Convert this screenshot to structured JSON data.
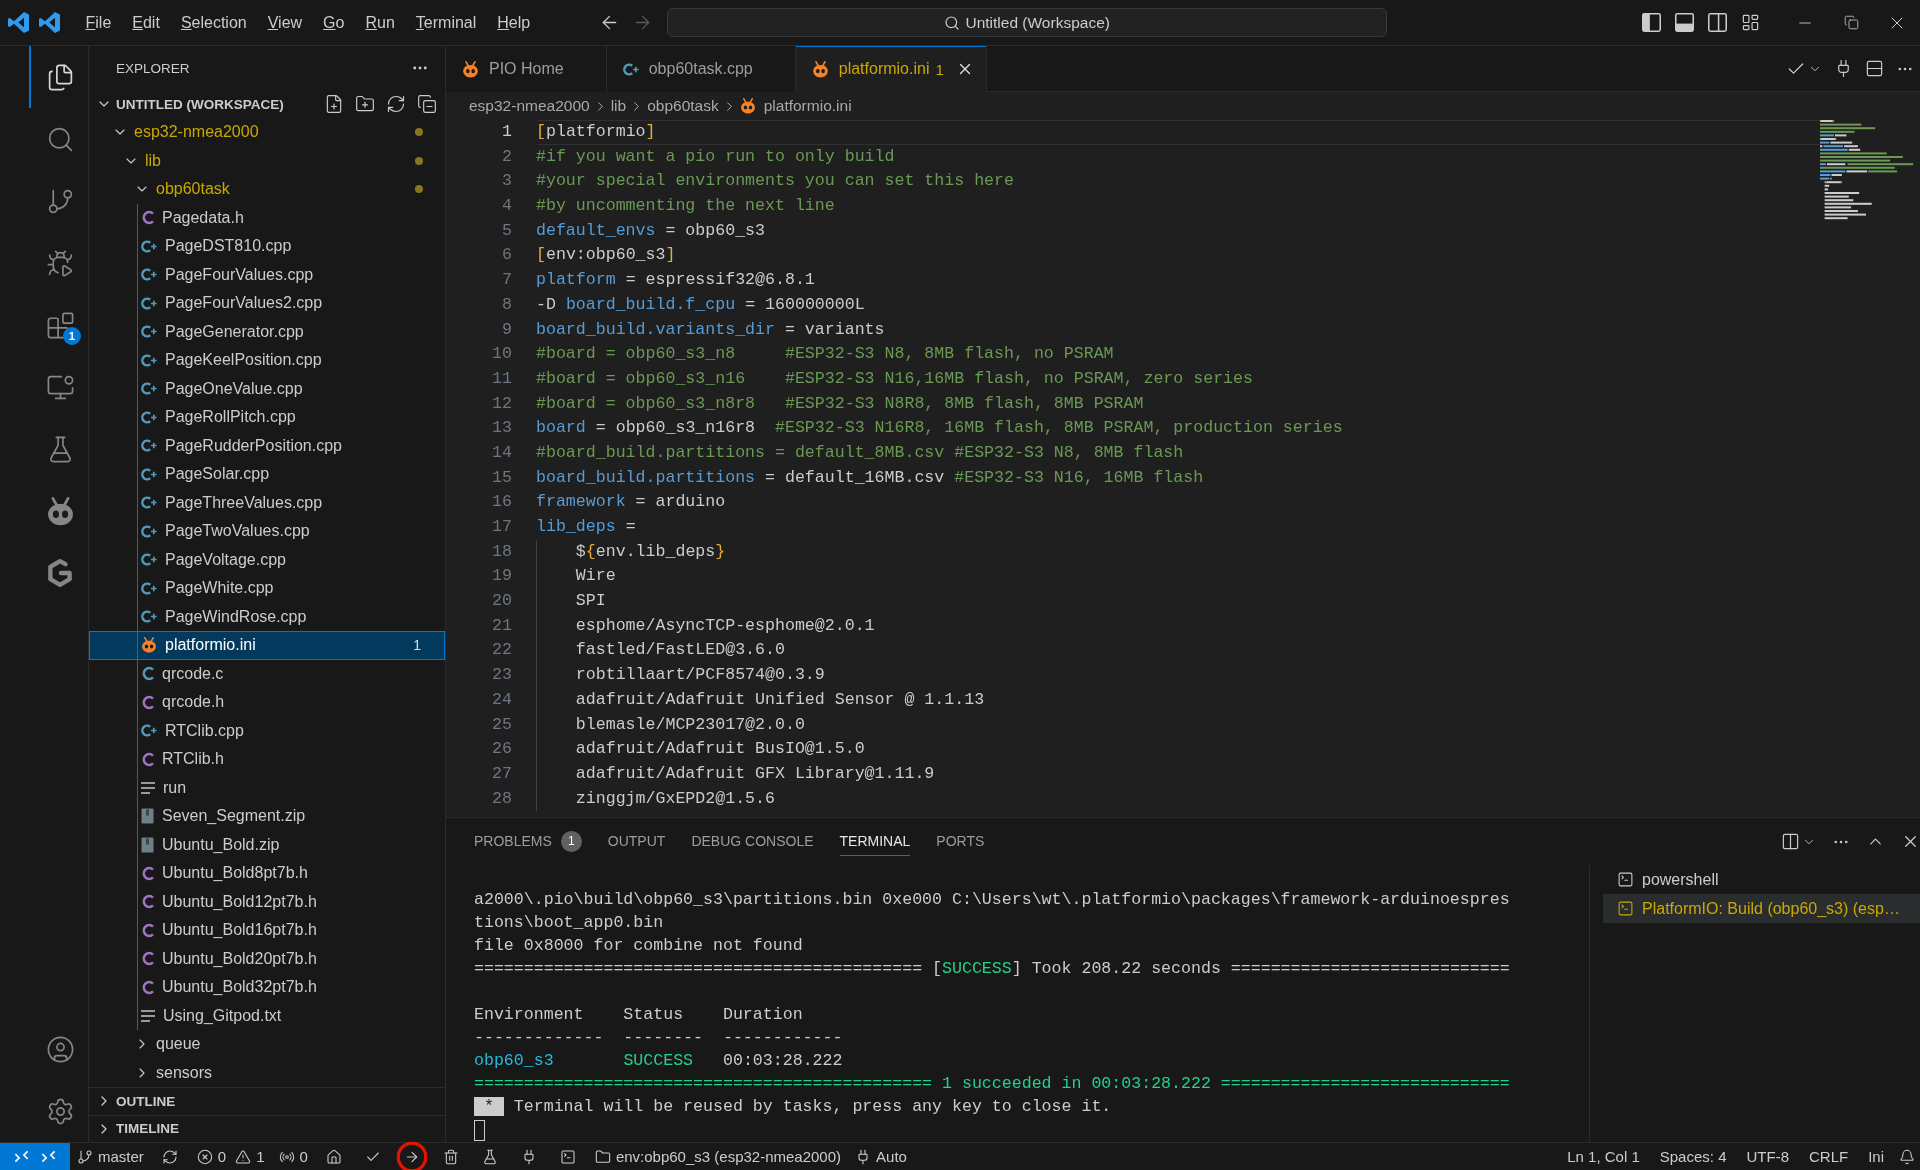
{
  "title_bar": {
    "menu": [
      "File",
      "Edit",
      "Selection",
      "View",
      "Go",
      "Run",
      "Terminal",
      "Help"
    ],
    "navigation": [
      {
        "kind": "back",
        "disabled": false
      },
      {
        "kind": "forward",
        "disabled": true
      }
    ],
    "command_center": "Untitled (Workspace)",
    "layout_toggles": [
      {
        "kind": "primary-sidebar",
        "on": true
      },
      {
        "kind": "panel",
        "on": true
      },
      {
        "kind": "secondary-sidebar",
        "on": false
      }
    ]
  },
  "activity_bar": {
    "top": [
      {
        "kind": "explorer",
        "selected": true
      },
      {
        "kind": "search",
        "selected": false
      },
      {
        "kind": "source-control",
        "selected": false
      },
      {
        "kind": "run-debug",
        "selected": false
      },
      {
        "kind": "extensions",
        "selected": false,
        "badge": "1"
      },
      {
        "kind": "remote-explorer",
        "selected": false
      },
      {
        "kind": "testing",
        "selected": false
      },
      {
        "kind": "platformio",
        "selected": false
      },
      {
        "kind": "gitpod",
        "selected": false
      }
    ],
    "bottom": [
      {
        "kind": "accounts"
      },
      {
        "kind": "manage"
      }
    ]
  },
  "explorer": {
    "title": "EXPLORER",
    "workspace": {
      "label": "UNTITLED (WORKSPACE)",
      "expanded": true
    },
    "tree": [
      {
        "label": "esp32-nmea2000",
        "kind": "folder",
        "expanded": true,
        "selected": false,
        "warning": true,
        "children": [
          {
            "label": "lib",
            "kind": "folder",
            "expanded": true,
            "selected": false,
            "warning": true,
            "children": [
              {
                "label": "obp60task",
                "kind": "folder",
                "expanded": true,
                "selected": false,
                "warning": true,
                "children": [
                  {
                    "label": "Pagedata.h",
                    "kind": "c-header",
                    "selected": false,
                    "warning": false
                  },
                  {
                    "label": "PageDST810.cpp",
                    "kind": "cpp",
                    "selected": false,
                    "warning": false
                  },
                  {
                    "label": "PageFourValues.cpp",
                    "kind": "cpp",
                    "selected": false,
                    "warning": false
                  },
                  {
                    "label": "PageFourValues2.cpp",
                    "kind": "cpp",
                    "selected": false,
                    "warning": false
                  },
                  {
                    "label": "PageGenerator.cpp",
                    "kind": "cpp",
                    "selected": false,
                    "warning": false
                  },
                  {
                    "label": "PageKeelPosition.cpp",
                    "kind": "cpp",
                    "selected": false,
                    "warning": false
                  },
                  {
                    "label": "PageOneValue.cpp",
                    "kind": "cpp",
                    "selected": false,
                    "warning": false
                  },
                  {
                    "label": "PageRollPitch.cpp",
                    "kind": "cpp",
                    "selected": false,
                    "warning": false
                  },
                  {
                    "label": "PageRudderPosition.cpp",
                    "kind": "cpp",
                    "selected": false,
                    "warning": false
                  },
                  {
                    "label": "PageSolar.cpp",
                    "kind": "cpp",
                    "selected": false,
                    "warning": false
                  },
                  {
                    "label": "PageThreeValues.cpp",
                    "kind": "cpp",
                    "selected": false,
                    "warning": false
                  },
                  {
                    "label": "PageTwoValues.cpp",
                    "kind": "cpp",
                    "selected": false,
                    "warning": false
                  },
                  {
                    "label": "PageVoltage.cpp",
                    "kind": "cpp",
                    "selected": false,
                    "warning": false
                  },
                  {
                    "label": "PageWhite.cpp",
                    "kind": "cpp",
                    "selected": false,
                    "warning": false
                  },
                  {
                    "label": "PageWindRose.cpp",
                    "kind": "cpp",
                    "selected": false,
                    "warning": false
                  },
                  {
                    "label": "platformio.ini",
                    "kind": "platformio",
                    "selected": true,
                    "warning": false,
                    "badge": "1"
                  },
                  {
                    "label": "qrcode.c",
                    "kind": "c-source",
                    "selected": false,
                    "warning": false
                  },
                  {
                    "label": "qrcode.h",
                    "kind": "c-header",
                    "selected": false,
                    "warning": false
                  },
                  {
                    "label": "RTClib.cpp",
                    "kind": "cpp",
                    "selected": false,
                    "warning": false
                  },
                  {
                    "label": "RTClib.h",
                    "kind": "c-header",
                    "selected": false,
                    "warning": false
                  },
                  {
                    "label": "run",
                    "kind": "text",
                    "selected": false,
                    "warning": false
                  },
                  {
                    "label": "Seven_Segment.zip",
                    "kind": "zip",
                    "selected": false,
                    "warning": false
                  },
                  {
                    "label": "Ubuntu_Bold.zip",
                    "kind": "zip",
                    "selected": false,
                    "warning": false
                  },
                  {
                    "label": "Ubuntu_Bold8pt7b.h",
                    "kind": "c-header",
                    "selected": false,
                    "warning": false
                  },
                  {
                    "label": "Ubuntu_Bold12pt7b.h",
                    "kind": "c-header",
                    "selected": false,
                    "warning": false
                  },
                  {
                    "label": "Ubuntu_Bold16pt7b.h",
                    "kind": "c-header",
                    "selected": false,
                    "warning": false
                  },
                  {
                    "label": "Ubuntu_Bold20pt7b.h",
                    "kind": "c-header",
                    "selected": false,
                    "warning": false
                  },
                  {
                    "label": "Ubuntu_Bold32pt7b.h",
                    "kind": "c-header",
                    "selected": false,
                    "warning": false
                  },
                  {
                    "label": "Using_Gitpod.txt",
                    "kind": "text",
                    "selected": false,
                    "warning": false
                  }
                ]
              },
              {
                "label": "queue",
                "kind": "folder",
                "expanded": false,
                "selected": false,
                "warning": false
              },
              {
                "label": "sensors",
                "kind": "folder",
                "expanded": false,
                "selected": false,
                "warning": false
              }
            ]
          }
        ]
      }
    ],
    "sections": [
      {
        "label": "OUTLINE",
        "expanded": false
      },
      {
        "label": "TIMELINE",
        "expanded": false
      }
    ]
  },
  "editor": {
    "tabs": [
      {
        "label": "PIO Home",
        "kind": "platformio",
        "selected": false,
        "warning": false
      },
      {
        "label": "obp60task.cpp",
        "kind": "cpp",
        "selected": false,
        "warning": false
      },
      {
        "label": "platformio.ini",
        "kind": "platformio",
        "selected": true,
        "warning": true,
        "badge": "1"
      }
    ],
    "breadcrumbs": [
      {
        "label": "esp32-nmea2000",
        "kind": "folder"
      },
      {
        "label": "lib",
        "kind": "folder"
      },
      {
        "label": "obp60task",
        "kind": "folder"
      },
      {
        "label": "platformio.ini",
        "kind": "platformio"
      }
    ],
    "lines": [
      {
        "number": "1",
        "current": true,
        "indented": false,
        "tokens": [
          {
            "kind": "bracket",
            "text": "["
          },
          {
            "kind": "text",
            "text": "platformio"
          },
          {
            "kind": "bracket",
            "text": "]"
          }
        ]
      },
      {
        "number": "2",
        "current": false,
        "indented": false,
        "tokens": [
          {
            "kind": "comment",
            "text": "#if you want a pio run to only build"
          }
        ]
      },
      {
        "number": "3",
        "current": false,
        "indented": false,
        "tokens": [
          {
            "kind": "comment",
            "text": "#your special environments you can set this here"
          }
        ]
      },
      {
        "number": "4",
        "current": false,
        "indented": false,
        "tokens": [
          {
            "kind": "comment",
            "text": "#by uncommenting the next line"
          }
        ]
      },
      {
        "number": "5",
        "current": false,
        "indented": false,
        "tokens": [
          {
            "kind": "key",
            "text": "default_envs"
          },
          {
            "kind": "text",
            "text": " = obp60_s3"
          }
        ]
      },
      {
        "number": "6",
        "current": false,
        "indented": false,
        "tokens": [
          {
            "kind": "bracket",
            "text": "["
          },
          {
            "kind": "text",
            "text": "env:obp60_s3"
          },
          {
            "kind": "bracket",
            "text": "]"
          }
        ]
      },
      {
        "number": "7",
        "current": false,
        "indented": false,
        "tokens": [
          {
            "kind": "key",
            "text": "platform"
          },
          {
            "kind": "text",
            "text": " = espressif32@6.8.1"
          }
        ]
      },
      {
        "number": "8",
        "current": false,
        "indented": false,
        "tokens": [
          {
            "kind": "text",
            "text": "-D "
          },
          {
            "kind": "key",
            "text": "board_build.f_cpu"
          },
          {
            "kind": "text",
            "text": " = 160000000L"
          }
        ]
      },
      {
        "number": "9",
        "current": false,
        "indented": false,
        "tokens": [
          {
            "kind": "key",
            "text": "board_build.variants_dir"
          },
          {
            "kind": "text",
            "text": " = variants"
          }
        ]
      },
      {
        "number": "10",
        "current": false,
        "indented": false,
        "tokens": [
          {
            "kind": "comment",
            "text": "#board = obp60_s3_n8     #ESP32-S3 N8, 8MB flash, no PSRAM"
          }
        ]
      },
      {
        "number": "11",
        "current": false,
        "indented": false,
        "tokens": [
          {
            "kind": "comment",
            "text": "#board = obp60_s3_n16    #ESP32-S3 N16,16MB flash, no PSRAM, zero series"
          }
        ]
      },
      {
        "number": "12",
        "current": false,
        "indented": false,
        "tokens": [
          {
            "kind": "comment",
            "text": "#board = obp60_s3_n8r8   #ESP32-S3 N8R8, 8MB flash, 8MB PSRAM"
          }
        ]
      },
      {
        "number": "13",
        "current": false,
        "indented": false,
        "tokens": [
          {
            "kind": "key",
            "text": "board"
          },
          {
            "kind": "text",
            "text": " = obp60_s3_n16r8  "
          },
          {
            "kind": "comment",
            "text": "#ESP32-S3 N16R8, 16MB flash, 8MB PSRAM, production series"
          }
        ]
      },
      {
        "number": "14",
        "current": false,
        "indented": false,
        "tokens": [
          {
            "kind": "comment",
            "text": "#board_build.partitions = default_8MB.csv #ESP32-S3 N8, 8MB flash"
          }
        ]
      },
      {
        "number": "15",
        "current": false,
        "indented": false,
        "tokens": [
          {
            "kind": "key",
            "text": "board_build.partitions"
          },
          {
            "kind": "text",
            "text": " = default_16MB.csv "
          },
          {
            "kind": "comment",
            "text": "#ESP32-S3 N16, 16MB flash"
          }
        ]
      },
      {
        "number": "16",
        "current": false,
        "indented": false,
        "tokens": [
          {
            "kind": "key",
            "text": "framework"
          },
          {
            "kind": "text",
            "text": " = arduino"
          }
        ]
      },
      {
        "number": "17",
        "current": false,
        "indented": false,
        "tokens": [
          {
            "kind": "key",
            "text": "lib_deps"
          },
          {
            "kind": "text",
            "text": " ="
          }
        ]
      },
      {
        "number": "18",
        "current": false,
        "indented": true,
        "tokens": [
          {
            "kind": "text",
            "text": "$"
          },
          {
            "kind": "bracket",
            "text": "{"
          },
          {
            "kind": "text",
            "text": "env.lib_deps"
          },
          {
            "kind": "bracket",
            "text": "}"
          }
        ]
      },
      {
        "number": "19",
        "current": false,
        "indented": true,
        "tokens": [
          {
            "kind": "text",
            "text": "Wire"
          }
        ]
      },
      {
        "number": "20",
        "current": false,
        "indented": true,
        "tokens": [
          {
            "kind": "text",
            "text": "SPI"
          }
        ]
      },
      {
        "number": "21",
        "current": false,
        "indented": true,
        "tokens": [
          {
            "kind": "text",
            "text": "esphome/AsyncTCP-esphome@2.0.1"
          }
        ]
      },
      {
        "number": "22",
        "current": false,
        "indented": true,
        "tokens": [
          {
            "kind": "text",
            "text": "fastled/FastLED@3.6.0"
          }
        ]
      },
      {
        "number": "23",
        "current": false,
        "indented": true,
        "tokens": [
          {
            "kind": "text",
            "text": "robtillaart/PCF8574@0.3.9"
          }
        ]
      },
      {
        "number": "24",
        "current": false,
        "indented": true,
        "tokens": [
          {
            "kind": "text",
            "text": "adafruit/Adafruit Unified Sensor @ 1.1.13"
          }
        ]
      },
      {
        "number": "25",
        "current": false,
        "indented": true,
        "tokens": [
          {
            "kind": "text",
            "text": "blemasle/MCP23017@2.0.0"
          }
        ]
      },
      {
        "number": "26",
        "current": false,
        "indented": true,
        "tokens": [
          {
            "kind": "text",
            "text": "adafruit/Adafruit BusIO@1.5.0"
          }
        ]
      },
      {
        "number": "27",
        "current": false,
        "indented": true,
        "tokens": [
          {
            "kind": "text",
            "text": "adafruit/Adafruit GFX Library@1.11.9"
          }
        ]
      },
      {
        "number": "28",
        "current": false,
        "indented": true,
        "tokens": [
          {
            "kind": "text",
            "text": "zinggjm/GxEPD2@1.5.6"
          }
        ]
      }
    ]
  },
  "panel": {
    "tabs": [
      {
        "label": "PROBLEMS",
        "selected": false,
        "badge": "1"
      },
      {
        "label": "OUTPUT",
        "selected": false
      },
      {
        "label": "DEBUG CONSOLE",
        "selected": false
      },
      {
        "label": "TERMINAL",
        "selected": true
      },
      {
        "label": "PORTS",
        "selected": false
      }
    ],
    "terminal": {
      "blocks": [
        {
          "lines": [
            {
              "segments": [
                {
                  "kind": "plain",
                  "text": "a2000\\.pio\\build\\obp60_s3\\partitions.bin 0xe000 C:\\Users\\wt\\.platformio\\packages\\framework-arduinoespres"
                }
              ]
            },
            {
              "segments": [
                {
                  "kind": "plain",
                  "text": "tions\\boot_app0.bin"
                }
              ]
            },
            {
              "segments": [
                {
                  "kind": "plain",
                  "text": "file 0x8000 for combine not found"
                }
              ]
            },
            {
              "segments": [
                {
                  "kind": "plain",
                  "text": "============================================= ["
                },
                {
                  "kind": "success",
                  "text": "SUCCESS"
                },
                {
                  "kind": "plain",
                  "text": "] Took 208.22 seconds ============================"
                }
              ]
            }
          ]
        },
        {
          "lines": [
            {
              "segments": [
                {
                  "kind": "plain",
                  "text": "Environment    Status    Duration"
                }
              ]
            },
            {
              "segments": [
                {
                  "kind": "plain",
                  "text": "-------------  --------  ------------"
                }
              ]
            },
            {
              "segments": [
                {
                  "kind": "info",
                  "text": "obp60_s3"
                },
                {
                  "kind": "success",
                  "text": "       SUCCESS"
                },
                {
                  "kind": "plain",
                  "text": "   00:03:28.222"
                }
              ]
            },
            {
              "segments": [
                {
                  "kind": "success",
                  "text": "============================================== 1 succeeded in 00:03:28.222 ============================="
                }
              ]
            },
            {
              "segments": [
                {
                  "kind": "inverse",
                  "text": " * "
                },
                {
                  "kind": "plain",
                  "text": " Terminal will be reused by tasks, press any key to close it."
                }
              ]
            }
          ]
        }
      ]
    },
    "sessions": [
      {
        "label": "powershell",
        "selected": false,
        "warning": false
      },
      {
        "label": "PlatformIO: Build (obp60_s3) (esp…",
        "selected": true,
        "warning": true
      }
    ]
  },
  "status_bar": {
    "left": [
      {
        "kind": "branch",
        "text": "master",
        "highlighted": false
      },
      {
        "kind": "sync",
        "highlighted": false
      },
      {
        "kind": "problems",
        "errors": "0",
        "warnings": "1",
        "highlighted": false
      },
      {
        "kind": "ports",
        "text": "0",
        "highlighted": false
      },
      {
        "kind": "home",
        "highlighted": false
      },
      {
        "kind": "build",
        "highlighted": false
      },
      {
        "kind": "upload",
        "highlighted": true
      },
      {
        "kind": "clean",
        "highlighted": false
      },
      {
        "kind": "test",
        "highlighted": false
      },
      {
        "kind": "monitor",
        "highlighted": false
      },
      {
        "kind": "terminal",
        "highlighted": false
      },
      {
        "kind": "env",
        "text": "env:obp60_s3 (esp32-nmea2000)",
        "highlighted": false
      },
      {
        "kind": "port",
        "text": "Auto",
        "highlighted": false
      }
    ],
    "right": [
      "Ln 1, Col 1",
      "Spaces: 4",
      "UTF-8",
      "CRLF",
      "Ini"
    ]
  }
}
